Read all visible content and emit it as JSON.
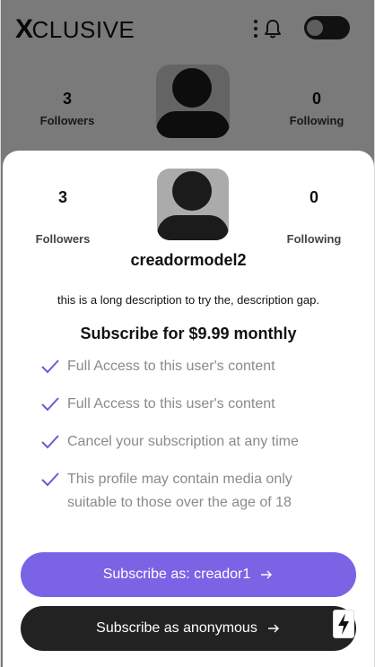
{
  "app": {
    "logo_mark": "X",
    "logo_text": "CLUSIVE"
  },
  "background_profile": {
    "followers_count": "3",
    "followers_label": "Followers",
    "following_count": "0",
    "following_label": "Following"
  },
  "modal": {
    "followers_count": "3",
    "followers_label": "Followers",
    "following_count": "0",
    "following_label": "Following",
    "username": "creadormodel2",
    "description": "this is a long description to try the, description gap.",
    "subscribe_title": "Subscribe for $9.99 monthly",
    "features": [
      "Full Access to this user's content",
      "Full Access to this user's content",
      "Cancel your subscription at any time",
      "This profile may contain media only suitable to those over the age of 18"
    ],
    "primary_button_label": "Subscribe as: creador1",
    "secondary_button_label": "Subscribe as anonymous"
  },
  "colors": {
    "accent": "#7b63e6",
    "dark": "#222222",
    "check": "#6d59d8"
  },
  "icons": [
    "kebab-menu-icon",
    "bell-icon",
    "check-icon",
    "arrow-right-icon",
    "bolt-icon"
  ]
}
